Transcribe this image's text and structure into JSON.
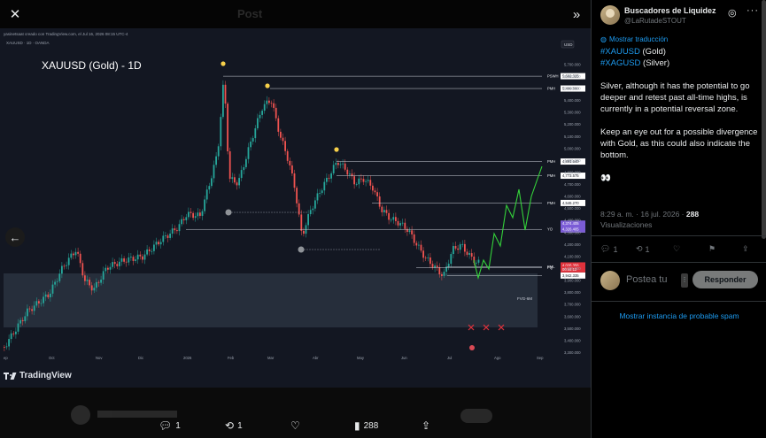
{
  "viewer": {
    "ghost_title": "Post",
    "close_icon": "✕",
    "expand_icon": "»",
    "prev_icon": "←"
  },
  "chart_header": {
    "published_line": "yasinetsaat creado con TradingView.com, el Jul 16, 2026 08:15 UTC-4",
    "symbol_line": "XAUUSD · 1D · OANDA",
    "title": "XAUUSD (Gold) - 1D",
    "currency": "USD",
    "watermark": "TradingView"
  },
  "chart_data": {
    "type": "candlestick",
    "title": "XAUUSD (Gold) - 1D",
    "xlabel": "",
    "ylabel": "",
    "x_ticks": [
      "ep",
      "Oct",
      "Nov",
      "Dic",
      "2026",
      "Feb",
      "Mar",
      "Abr",
      "May",
      "Jun",
      "Jul",
      "Ago",
      "Sep"
    ],
    "y_ticks": [
      5700,
      5600,
      5500,
      5400,
      5300,
      5200,
      5100,
      5000,
      4900,
      4800,
      4700,
      4600,
      4500,
      4400,
      4300,
      4200,
      4100,
      4000,
      3900,
      3800,
      3700,
      3600,
      3500,
      3400,
      3300
    ],
    "y_tick_labels": [
      "5,700.000",
      "5,600.000",
      "5,500.000",
      "5,400.000",
      "5,300.000",
      "5,200.000",
      "5,100.000",
      "5,000.000",
      "4,900.000",
      "4,800.000",
      "4,700.000",
      "4,600.000",
      "4,500.000",
      "4,400.000",
      "4,300.000",
      "4,200.000",
      "4,100.000",
      "4,000.000",
      "3,900.000",
      "3,800.000",
      "3,700.000",
      "3,600.000",
      "3,500.000",
      "3,400.000",
      "3,300.000"
    ],
    "ylim": [
      3230,
      5780
    ],
    "levels": [
      {
        "label": "PSWH",
        "value": 5602.325,
        "price": "5,602.325"
      },
      {
        "label": "PMH",
        "value": 5499.66,
        "price": "5,499.660"
      },
      {
        "label": "PMH",
        "value": 4891.54,
        "price": "4,891.540"
      },
      {
        "label": "PMH",
        "value": 4773.575,
        "price": "4,773.575"
      },
      {
        "label": "PMH",
        "value": 4546.27,
        "price": "4,546.270"
      },
      {
        "label": "YO",
        "value": 4326.405,
        "price": "4,326.405"
      },
      {
        "label": "PQ",
        "value": 4008.35,
        "price": "4,008.350"
      },
      {
        "label": "PML",
        "value": 4014.346,
        "price": "4,014.346"
      },
      {
        "label": "",
        "value": 3942.335,
        "price": "3,942.335"
      }
    ],
    "highlighted_prices": [
      {
        "price": "4,374.405",
        "value": 4374.405,
        "color": "#7b5cd6"
      },
      {
        "price": "4,326.405",
        "value": 4326.405,
        "color": "#7b5cd6"
      },
      {
        "price": "4,026.356",
        "value": 4026.356,
        "color": "#e0323c"
      },
      {
        "price": "00:44:12",
        "value": 3994,
        "color": "#e0323c"
      }
    ],
    "zone_label": "FVG-6M",
    "zone_range": [
      3510,
      3960
    ],
    "projection_color": "#34d23a",
    "bull_color": "#26a69a",
    "bear_color": "#ef5350"
  },
  "actions": {
    "reply_count": "1",
    "repost_count": "1",
    "views_count": "288"
  },
  "panel": {
    "author_name": "Buscadores de Liquidez",
    "author_handle": "@LaRutadeSTOUT",
    "translate_label": "Mostrar traducción",
    "tag_gold": "#XAUUSD",
    "gold_suffix": " (Gold)",
    "tag_silver": "#XAGUSD",
    "silver_suffix": " (Silver)",
    "paragraph1": "Silver, although it has the potential to go deeper and retest past all-time highs, is currently in a potential reversal zone.",
    "paragraph2": "Keep an eye out for a possible divergence with Gold, as this could also indicate the bottom.",
    "emoji": "👀",
    "timestamp": "8:29 a. m. · 16 jul. 2026 · ",
    "views_num": "288",
    "views_label": "Visualizaciones",
    "reply_count": "1",
    "repost_count": "1",
    "reply_placeholder": "Postea tu",
    "reply_button": "Responder",
    "spam_link": "Mostrar instancia de probable spam"
  }
}
